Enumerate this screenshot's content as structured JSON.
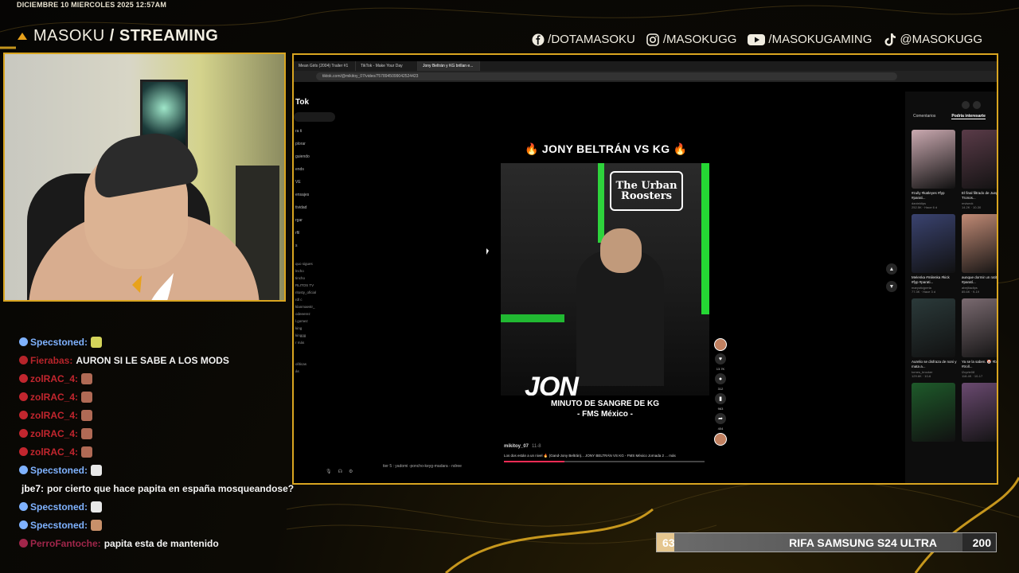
{
  "overlay": {
    "datetime": "DICIEMBRE 10 MIERCOLES 2025 12:57AM",
    "brand_light": "MASOKU",
    "brand_bold": "/ STREAMING",
    "socials": [
      {
        "icon": "facebook-icon",
        "label": "/DOTAMASOKU"
      },
      {
        "icon": "instagram-icon",
        "label": "/MASOKUGG"
      },
      {
        "icon": "youtube-icon",
        "label": "/MASOKUGAMING"
      },
      {
        "icon": "tiktok-icon",
        "label": "@MASOKUGG"
      }
    ],
    "accent": "#d9a520"
  },
  "chat": [
    {
      "user": "Specstoned:",
      "msg": "",
      "color": "#7fb2ff",
      "emote": "#d4d45a"
    },
    {
      "user": "Fierabas:",
      "msg": "AURON SI LE SABE A LOS MODS",
      "color": "#b6242a",
      "emote": ""
    },
    {
      "user": "zolRAC_4:",
      "msg": "",
      "color": "#c2262e",
      "emote": "#b06a55"
    },
    {
      "user": "zolRAC_4:",
      "msg": "",
      "color": "#c2262e",
      "emote": "#b06a55"
    },
    {
      "user": "zolRAC_4:",
      "msg": "",
      "color": "#c2262e",
      "emote": "#b06a55"
    },
    {
      "user": "zolRAC_4:",
      "msg": "",
      "color": "#c2262e",
      "emote": "#b06a55"
    },
    {
      "user": "zolRAC_4:",
      "msg": "",
      "color": "#c2262e",
      "emote": "#b06a55"
    },
    {
      "user": "Specstoned:",
      "msg": "",
      "color": "#7fb2ff",
      "emote": "#e8e8e8"
    },
    {
      "user": "jbe7:",
      "msg": "por cierto que hace papita en españa mosqueandose?",
      "color": "#ffffff",
      "emote": ""
    },
    {
      "user": "Specstoned:",
      "msg": "",
      "color": "#7fb2ff",
      "emote": "#e8e8e8"
    },
    {
      "user": "Specstoned:",
      "msg": "",
      "color": "#7fb2ff",
      "emote": "#c8906a"
    },
    {
      "user": "PerroFantoche:",
      "msg": "papita esta de mantenido",
      "color": "#a0264a",
      "emote": ""
    }
  ],
  "browser": {
    "tabs": [
      "Mean Girls (2004) Trailer #1",
      "TikTok - Make Your Day",
      "Jony Beltrán y KG brillan e..."
    ],
    "url": "tiktok.com/@mikitoy_07/video/7578945099042524423",
    "logo": "Tok",
    "side_nav": [
      "ra ti",
      "plorar",
      "guiendo",
      "ends",
      "VE",
      "ensajes",
      "tividad",
      "rgar",
      "rfil",
      "s"
    ],
    "following": [
      "quo sigues",
      "lncho",
      "tincho",
      "RLITOS TV",
      "ritosty_oficial",
      "rdl c",
      "klanmaestr_",
      "odeeerez",
      "l.gomez",
      "king",
      "kinggg",
      "r más",
      "",
      "",
      "olíticas",
      "ás"
    ],
    "video_title": "🔥 JONY BELTRÁN VS KG 🔥",
    "video_logo": "The Urban Roosters",
    "jon_text": "JON",
    "caption_1": "MINUTO DE SANGRE DE KG",
    "caption_2": "- FMS México -",
    "author": "mikitoy_07",
    "author_date": "11-8",
    "description": "Los dos están a un nivel 🔥 (Gand-Jony Beltrán)... JONY BELTRÁN VS KG - FMS México Jornada 2 ... más",
    "progress": 0.3,
    "actions": [
      "13.7K",
      "312",
      "963",
      "404"
    ],
    "ticker": "tier 5 : yadomi -poncho-keyg-madara - ndree",
    "right_tabs": [
      "Comentarios",
      "Podría interesarte"
    ],
    "recommended": [
      {
        "title": "#zully #katleyes #fyp #parati...",
        "meta": "danieldips\n252.5K · Hace 6 d",
        "color": "#caa9b0"
      },
      {
        "title": "El final filtrado de Juego de Tronos...",
        "meta": "mviseck\n14.2K · 10-30",
        "color": "#5a3b48"
      },
      {
        "title": "Melenka #milenka #kick #fyp #parati...",
        "meta": "maryoticjperla\n77.3K · Hace 3 d",
        "color": "#3a4370"
      },
      {
        "title": "aunque dormir un ratito 😴 #paratí...",
        "meta": "abejitaclips\n85.6K · 9-19",
        "color": "#c08a75"
      },
      {
        "title": "Aurelio se disfraza de noni y mata a...",
        "meta": "tomes_brocker\n129.6K · 10-6",
        "color": "#2b3a3a"
      },
      {
        "title": "Ya se la saben. 🤡 #broma #troll...",
        "meta": "l2cyrte08\n118.4K · 10-17",
        "color": "#7a6a70"
      },
      {
        "title": "",
        "meta": "",
        "color": "#1e5a2a"
      },
      {
        "title": "",
        "meta": "",
        "color": "#6a4a70"
      }
    ]
  },
  "raffle": {
    "left": "63",
    "label": "RIFA SAMSUNG S24 ULTRA",
    "right": "200",
    "progress_ratio": 0.315
  }
}
